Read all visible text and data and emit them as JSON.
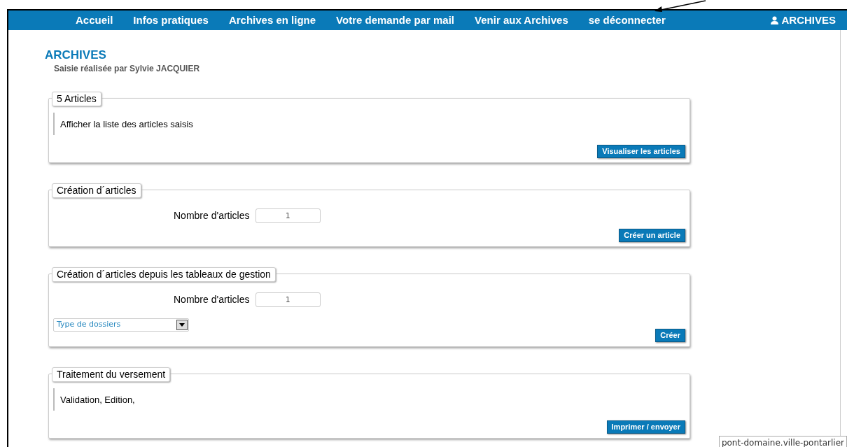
{
  "nav": {
    "items": [
      "Accueil",
      "Infos pratiques",
      "Archives en ligne",
      "Votre demande par mail",
      "Venir aux Archives",
      "se déconnecter"
    ],
    "user": "ARCHIVES"
  },
  "page": {
    "title": "ARCHIVES",
    "subtitle": "Saisie réalisée par Sylvie JACQUIER"
  },
  "sections": [
    {
      "kind": "note",
      "legend": "5 Articles",
      "note": "Afficher la liste des articles saisis",
      "button": "Visualiser les articles"
    },
    {
      "kind": "count",
      "legend": "Création d´articles",
      "field_label": "Nombre d'articles",
      "field_value": "1",
      "button": "Créer un article"
    },
    {
      "kind": "count_select",
      "legend": "Création d´articles depuis les tableaux de gestion",
      "field_label": "Nombre d'articles",
      "field_value": "1",
      "select": "Type de dossiers",
      "button": "Créer"
    },
    {
      "kind": "note",
      "legend": "Traitement du versement",
      "note": "Validation, Edition,",
      "button": "Imprimer / envoyer"
    }
  ],
  "status_url": "pont-domaine.ville-pontarlier"
}
